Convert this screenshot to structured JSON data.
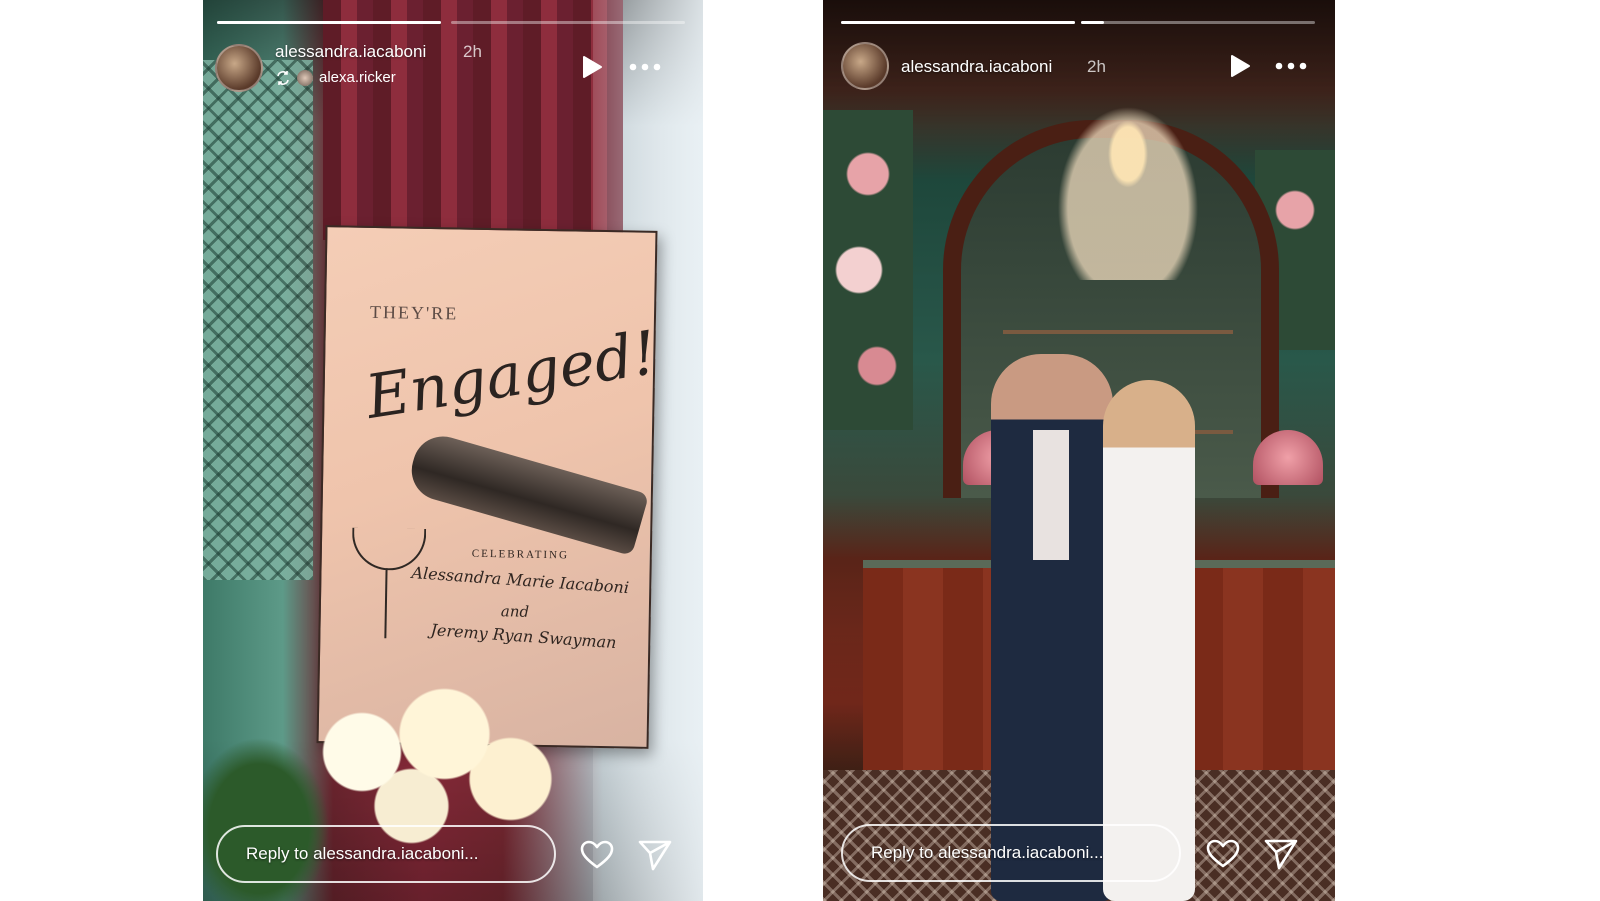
{
  "stories": [
    {
      "username": "alessandra.iacaboni",
      "time": "2h",
      "reposted_from": "alexa.ricker",
      "progress": [
        1.0,
        0.0
      ],
      "reply_placeholder": "Reply to alessandra.iacaboni...",
      "sign": {
        "line1": "THEY'RE",
        "line2": "Engaged!",
        "line3": "CELEBRATING",
        "line4": "Alessandra Marie Iacaboni",
        "line5": "and",
        "line6": "Jeremy Ryan Swayman"
      },
      "icons": [
        "play-icon",
        "more-icon",
        "heart-icon",
        "send-icon",
        "repost-icon"
      ]
    },
    {
      "username": "alessandra.iacaboni",
      "time": "2h",
      "progress": [
        1.0,
        0.1
      ],
      "reply_placeholder": "Reply to alessandra.iacaboni...",
      "icons": [
        "play-icon",
        "more-icon",
        "heart-icon",
        "send-icon"
      ]
    }
  ],
  "colors": {
    "overlay_text": "#ffffff",
    "progress_track": "rgba(255,255,255,0.4)",
    "progress_fill": "#ffffff"
  }
}
